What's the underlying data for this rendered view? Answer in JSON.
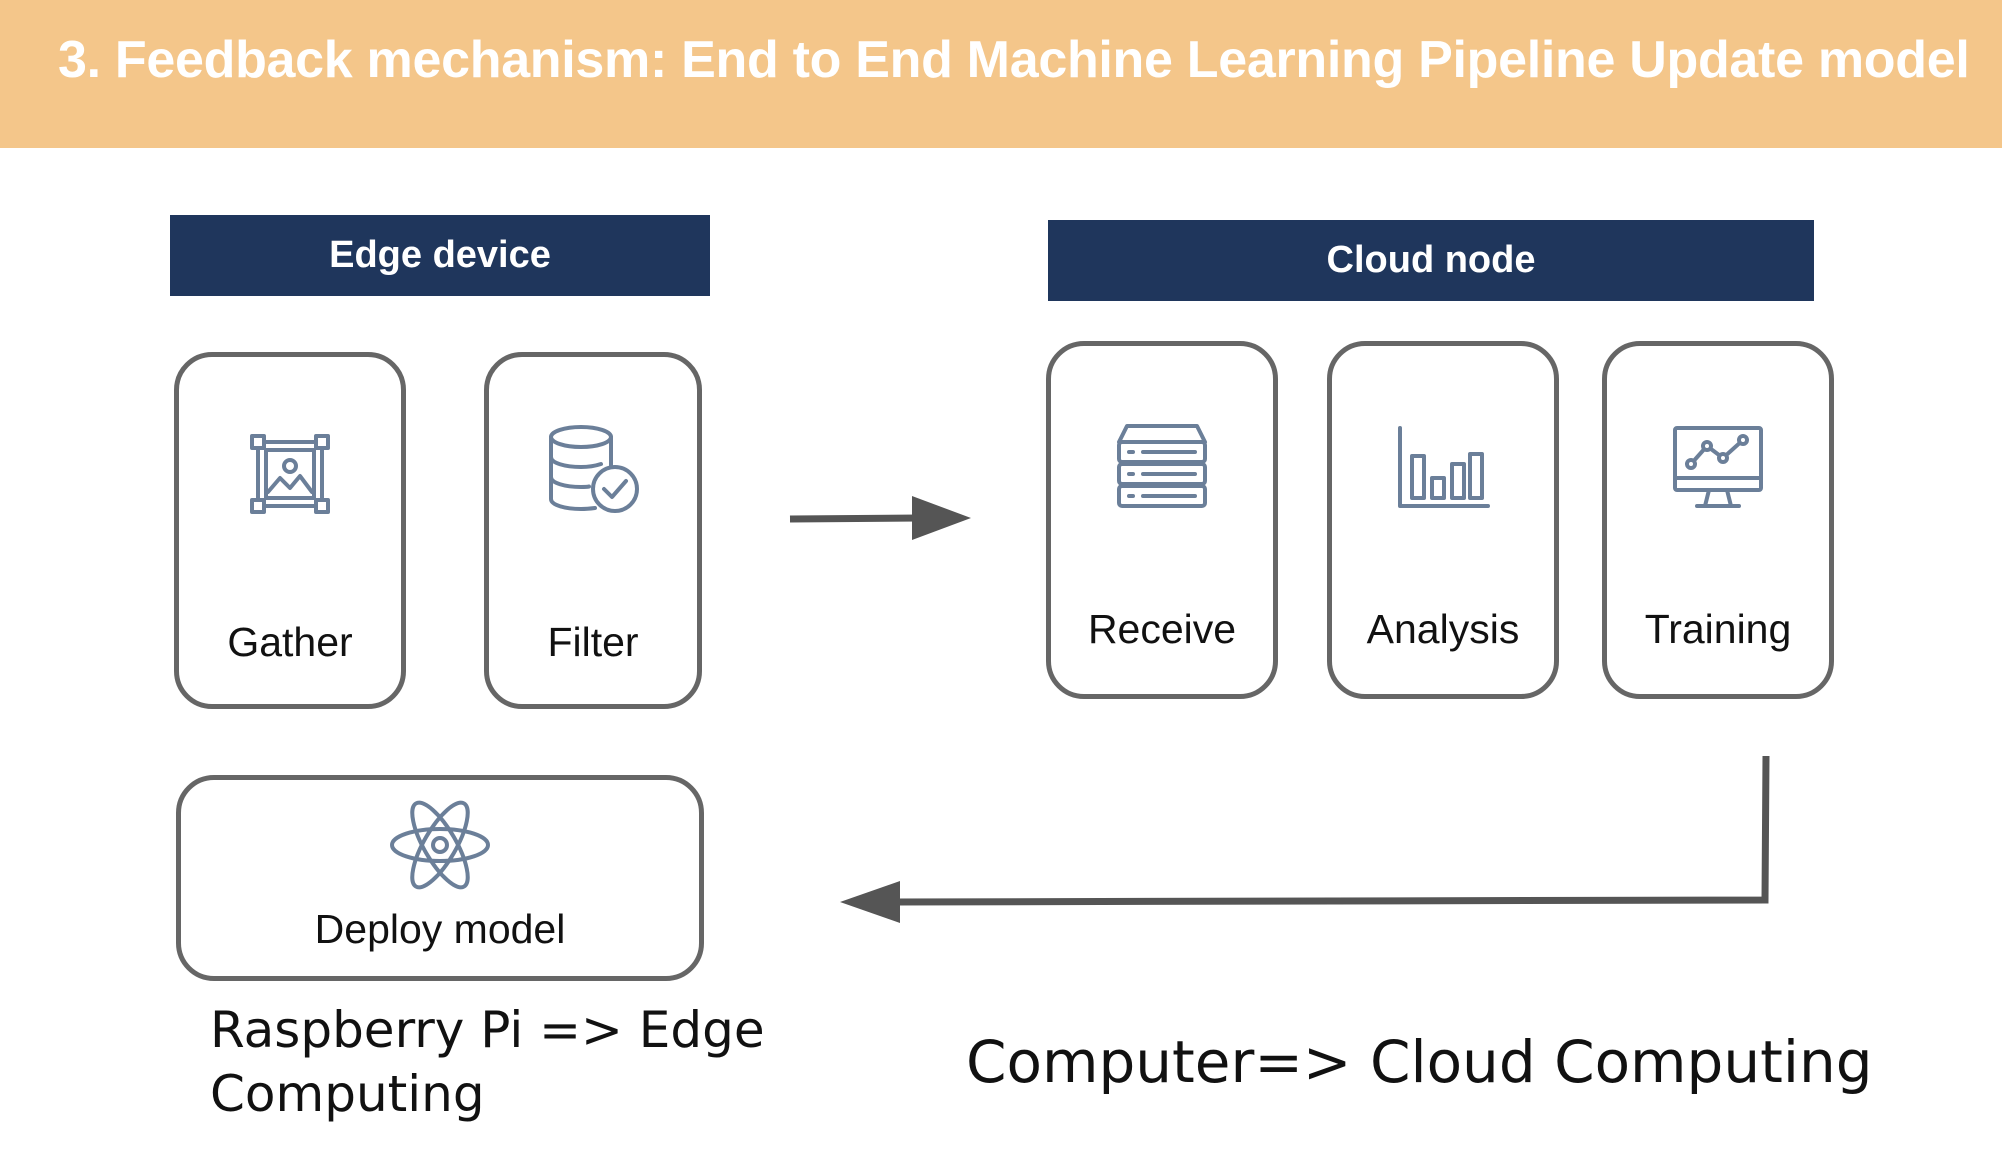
{
  "title": "3. Feedback mechanism: End to End Machine Learning Pipeline Update model",
  "colors": {
    "title_bar": "#f4c68a",
    "header_bg": "#1f365c",
    "box_border": "#666666",
    "icon": "#6b7f99",
    "arrow": "#555555"
  },
  "edge": {
    "header": "Edge device",
    "steps": [
      {
        "label": "Gather",
        "icon": "image-frame-icon"
      },
      {
        "label": "Filter",
        "icon": "database-check-icon"
      }
    ],
    "deploy": {
      "label": "Deploy model",
      "icon": "atom-icon"
    },
    "caption": "Raspberry Pi => Edge Computing"
  },
  "cloud": {
    "header": "Cloud node",
    "steps": [
      {
        "label": "Receive",
        "icon": "server-stack-icon"
      },
      {
        "label": "Analysis",
        "icon": "bar-chart-icon"
      },
      {
        "label": "Training",
        "icon": "monitor-line-chart-icon"
      }
    ],
    "caption": "Computer=> Cloud Computing"
  }
}
